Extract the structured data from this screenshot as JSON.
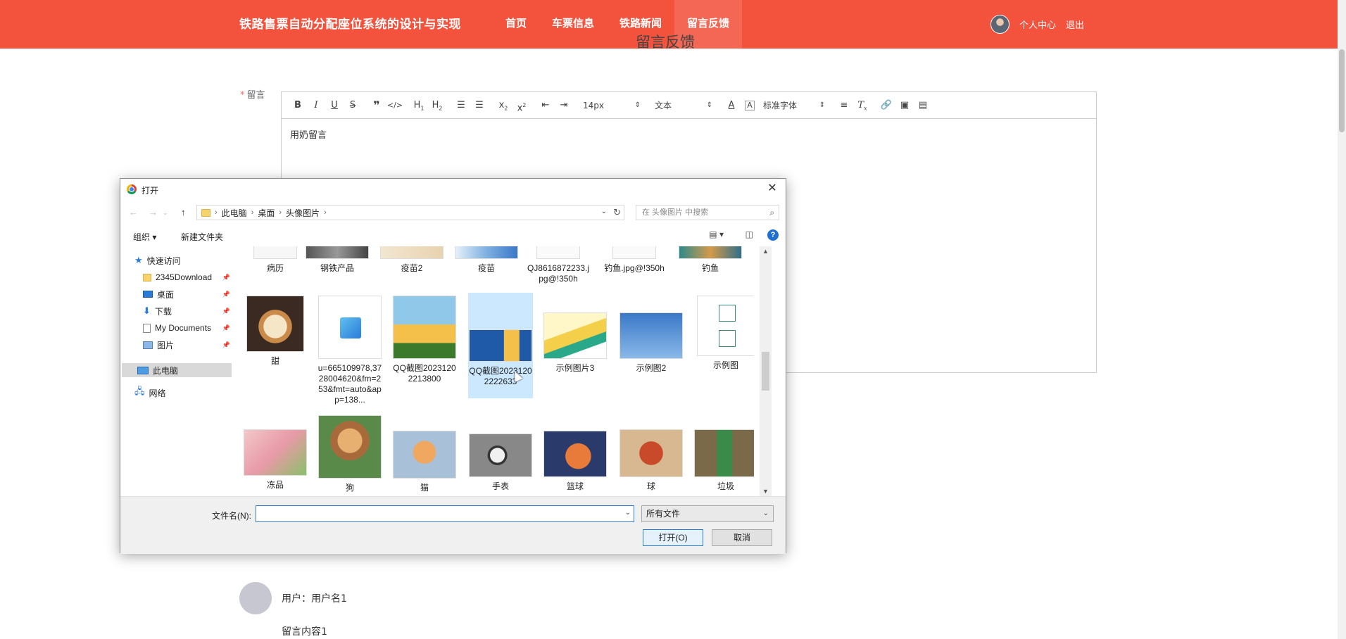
{
  "header": {
    "brand": "铁路售票自动分配座位系统的设计与实现",
    "nav": [
      "首页",
      "车票信息",
      "铁路新闻",
      "留言反馈"
    ],
    "active_nav": "留言反馈",
    "user_center": "个人中心",
    "logout": "退出"
  },
  "page": {
    "heading": "留言反馈"
  },
  "form": {
    "label": "留言",
    "required_mark": "*",
    "editor_text": "用奶留言",
    "font_size": "14px",
    "format": "文本",
    "font_family": "标准字体"
  },
  "comment": {
    "user": "用户：用户名1",
    "body": "留言内容1"
  },
  "dialog": {
    "title": "打开",
    "breadcrumb": [
      "此电脑",
      "桌面",
      "头像图片"
    ],
    "search_placeholder": "在 头像图片 中搜索",
    "organize": "组织",
    "new_folder": "新建文件夹",
    "sidebar": {
      "quick_access": "快速访问",
      "pinned": [
        "2345Download",
        "桌面",
        "下载",
        "My Documents",
        "图片"
      ],
      "this_pc": "此电脑",
      "network": "网络"
    },
    "files_row1": [
      "病历",
      "钢铁产品",
      "疫苗2",
      "疫苗",
      "QJ8616872233.jpg@!350h",
      "钓鱼.jpg@!350h",
      "钓鱼"
    ],
    "files_row2": [
      "甜",
      "u=665109978,3728004620&fm=253&fmt=auto&app=138...",
      "QQ截图20231202213800",
      "QQ截图20231202222633",
      "示例图片3",
      "示例图2",
      "示例图"
    ],
    "files_row3": [
      "冻品",
      "狗",
      "猫",
      "手表",
      "篮球",
      "球",
      "垃圾"
    ],
    "filename_label": "文件名(N):",
    "filter": "所有文件",
    "open_button": "打开(O)",
    "cancel_button": "取消"
  },
  "colors": {
    "header_bg": "#f3523d",
    "selection": "#cce8ff",
    "accent": "#2b7bd8"
  }
}
